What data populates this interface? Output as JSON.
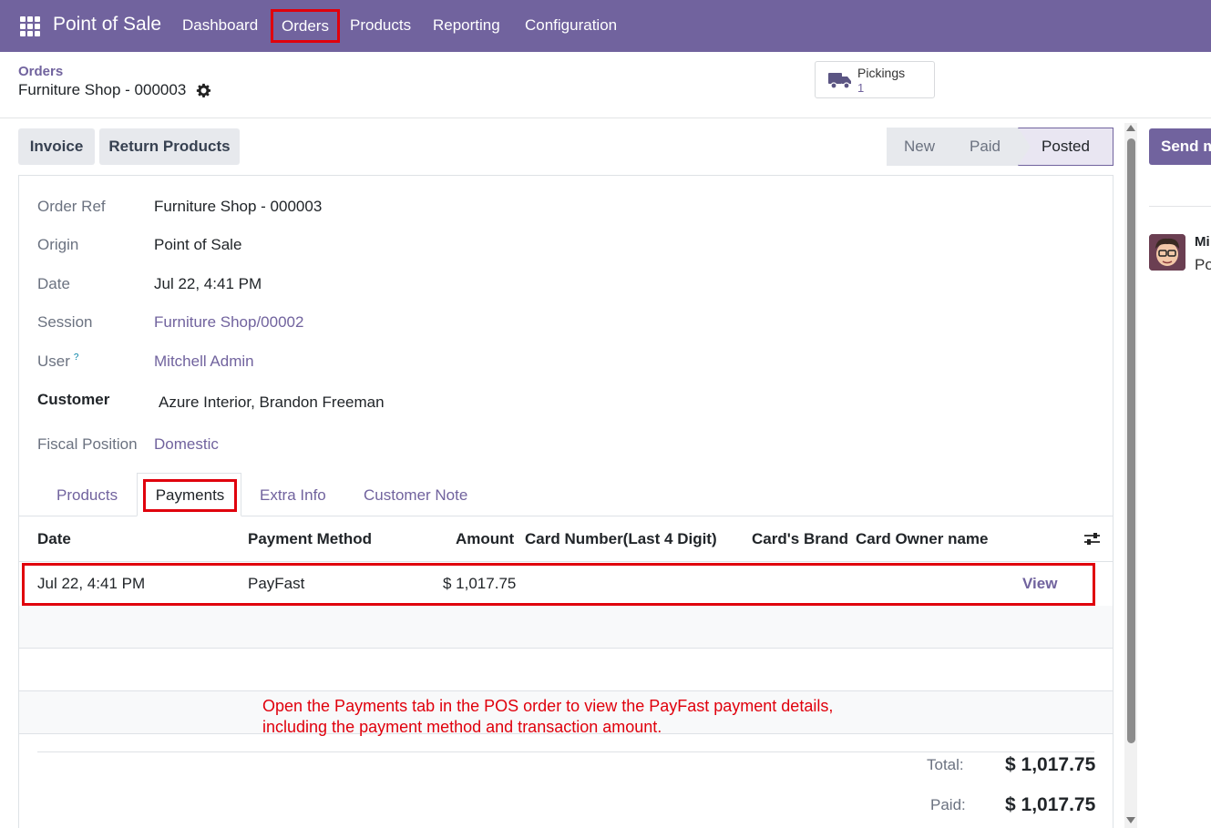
{
  "navbar": {
    "brand": "Point of Sale",
    "items": [
      "Dashboard",
      "Orders",
      "Products",
      "Reporting",
      "Configuration"
    ]
  },
  "breadcrumb": {
    "parent": "Orders",
    "current": "Furniture Shop - 000003"
  },
  "smart_button": {
    "label": "Pickings",
    "count": "1"
  },
  "actions": {
    "invoice": "Invoice",
    "return_products": "Return Products",
    "send": "Send m"
  },
  "statusbar": [
    "New",
    "Paid",
    "Posted"
  ],
  "form": {
    "order_ref": {
      "label": "Order Ref",
      "value": "Furniture Shop - 000003"
    },
    "origin": {
      "label": "Origin",
      "value": "Point of Sale"
    },
    "date": {
      "label": "Date",
      "value": "Jul 22, 4:41 PM"
    },
    "session": {
      "label": "Session",
      "value": "Furniture Shop/00002"
    },
    "user": {
      "label": "User",
      "help": "?",
      "value": "Mitchell Admin"
    },
    "customer": {
      "label": "Customer",
      "value": "Azure Interior, Brandon Freeman"
    },
    "fiscal_position": {
      "label": "Fiscal Position",
      "value": "Domestic"
    }
  },
  "tabs": [
    "Products",
    "Payments",
    "Extra Info",
    "Customer Note"
  ],
  "payments_table": {
    "headers": [
      "Date",
      "Payment Method",
      "Amount",
      "Card Number(Last 4 Digit)",
      "Card's Brand",
      "Card Owner name"
    ],
    "rows": [
      {
        "date": "Jul 22, 4:41 PM",
        "method": "PayFast",
        "amount": "$ 1,017.75",
        "action": "View"
      }
    ]
  },
  "annotation": {
    "line1": "Open the Payments tab in the POS order to view the PayFast payment details,",
    "line2": "including the payment method and transaction amount."
  },
  "totals": {
    "total_label": "Total:",
    "total_value": "$ 1,017.75",
    "paid_label": "Paid:",
    "paid_value": "$ 1,017.75"
  },
  "chatter": {
    "author": "Mi",
    "message": "Po"
  },
  "colors": {
    "brand": "#71639e",
    "highlight": "#e0000c"
  }
}
